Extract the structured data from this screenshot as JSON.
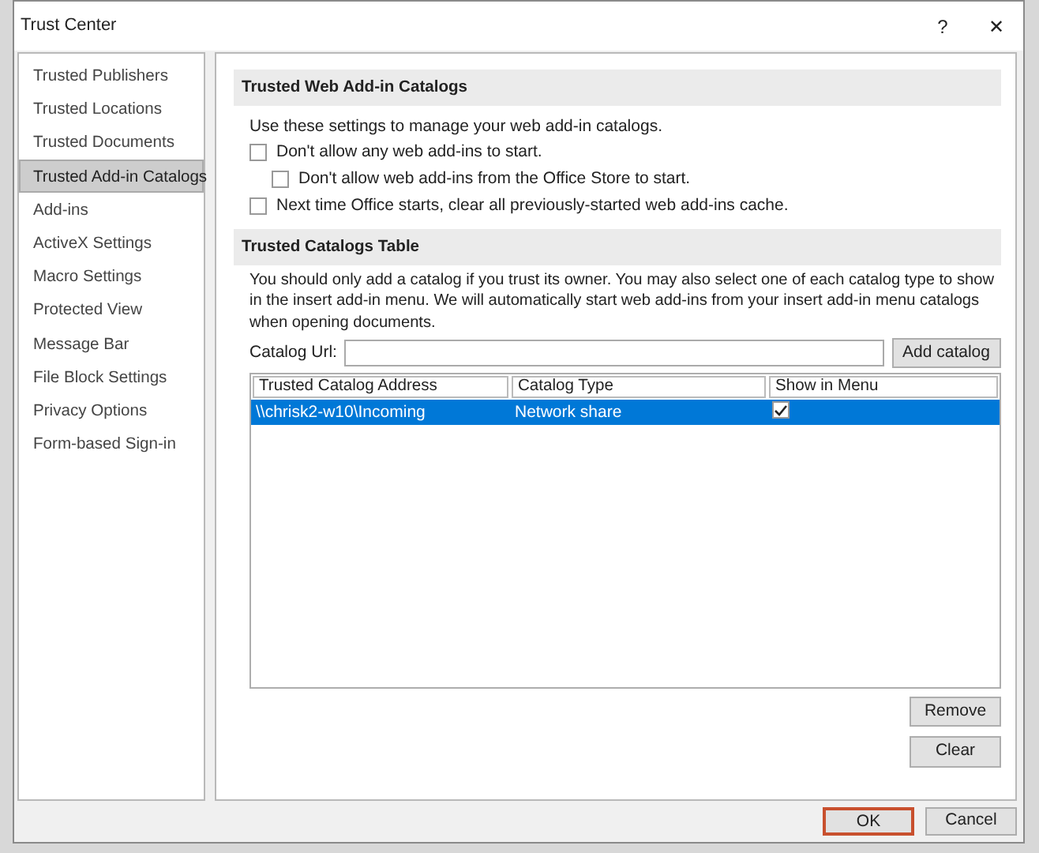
{
  "window": {
    "title": "Trust Center",
    "help": "?",
    "close": "✕"
  },
  "sidebar": {
    "items": [
      {
        "label": "Trusted Publishers",
        "selected": false
      },
      {
        "label": "Trusted Locations",
        "selected": false
      },
      {
        "label": "Trusted Documents",
        "selected": false
      },
      {
        "label": "Trusted Add-in Catalogs",
        "selected": true
      },
      {
        "label": "Add-ins",
        "selected": false
      },
      {
        "label": "ActiveX Settings",
        "selected": false
      },
      {
        "label": "Macro Settings",
        "selected": false
      },
      {
        "label": "Protected View",
        "selected": false
      },
      {
        "label": "Message Bar",
        "selected": false
      },
      {
        "label": "File Block Settings",
        "selected": false
      },
      {
        "label": "Privacy Options",
        "selected": false
      },
      {
        "label": "Form-based Sign-in",
        "selected": false
      }
    ]
  },
  "web_catalogs": {
    "heading": "Trusted Web Add-in Catalogs",
    "intro": "Use these settings to manage your web add-in catalogs.",
    "options": [
      {
        "label": "Don't allow any web add-ins to start.",
        "checked": false,
        "children": [
          {
            "label": "Don't allow web add-ins from the Office Store to start.",
            "checked": false
          }
        ]
      },
      {
        "label": "Next time Office starts, clear all previously-started web add-ins cache.",
        "checked": false
      }
    ]
  },
  "catalogs_table": {
    "heading": "Trusted Catalogs Table",
    "note": "You should only add a catalog if you trust its owner. You may also select one of each catalog type to show in the insert add-in menu. We will automatically start web add-ins from your insert add-in menu catalogs when opening documents.",
    "url_label": "Catalog Url:",
    "add_button": "Add catalog",
    "columns": [
      "Trusted Catalog Address",
      "Catalog Type",
      "Show in Menu"
    ],
    "rows": [
      {
        "address": "\\\\chrisk2-w10\\Incoming",
        "type": "Network share",
        "show_in_menu": true,
        "selected": true
      }
    ],
    "remove_button": "Remove",
    "clear_button": "Clear"
  },
  "buttons": [
    {
      "label": "OK",
      "default": true
    },
    {
      "label": "Cancel",
      "default": false
    }
  ]
}
